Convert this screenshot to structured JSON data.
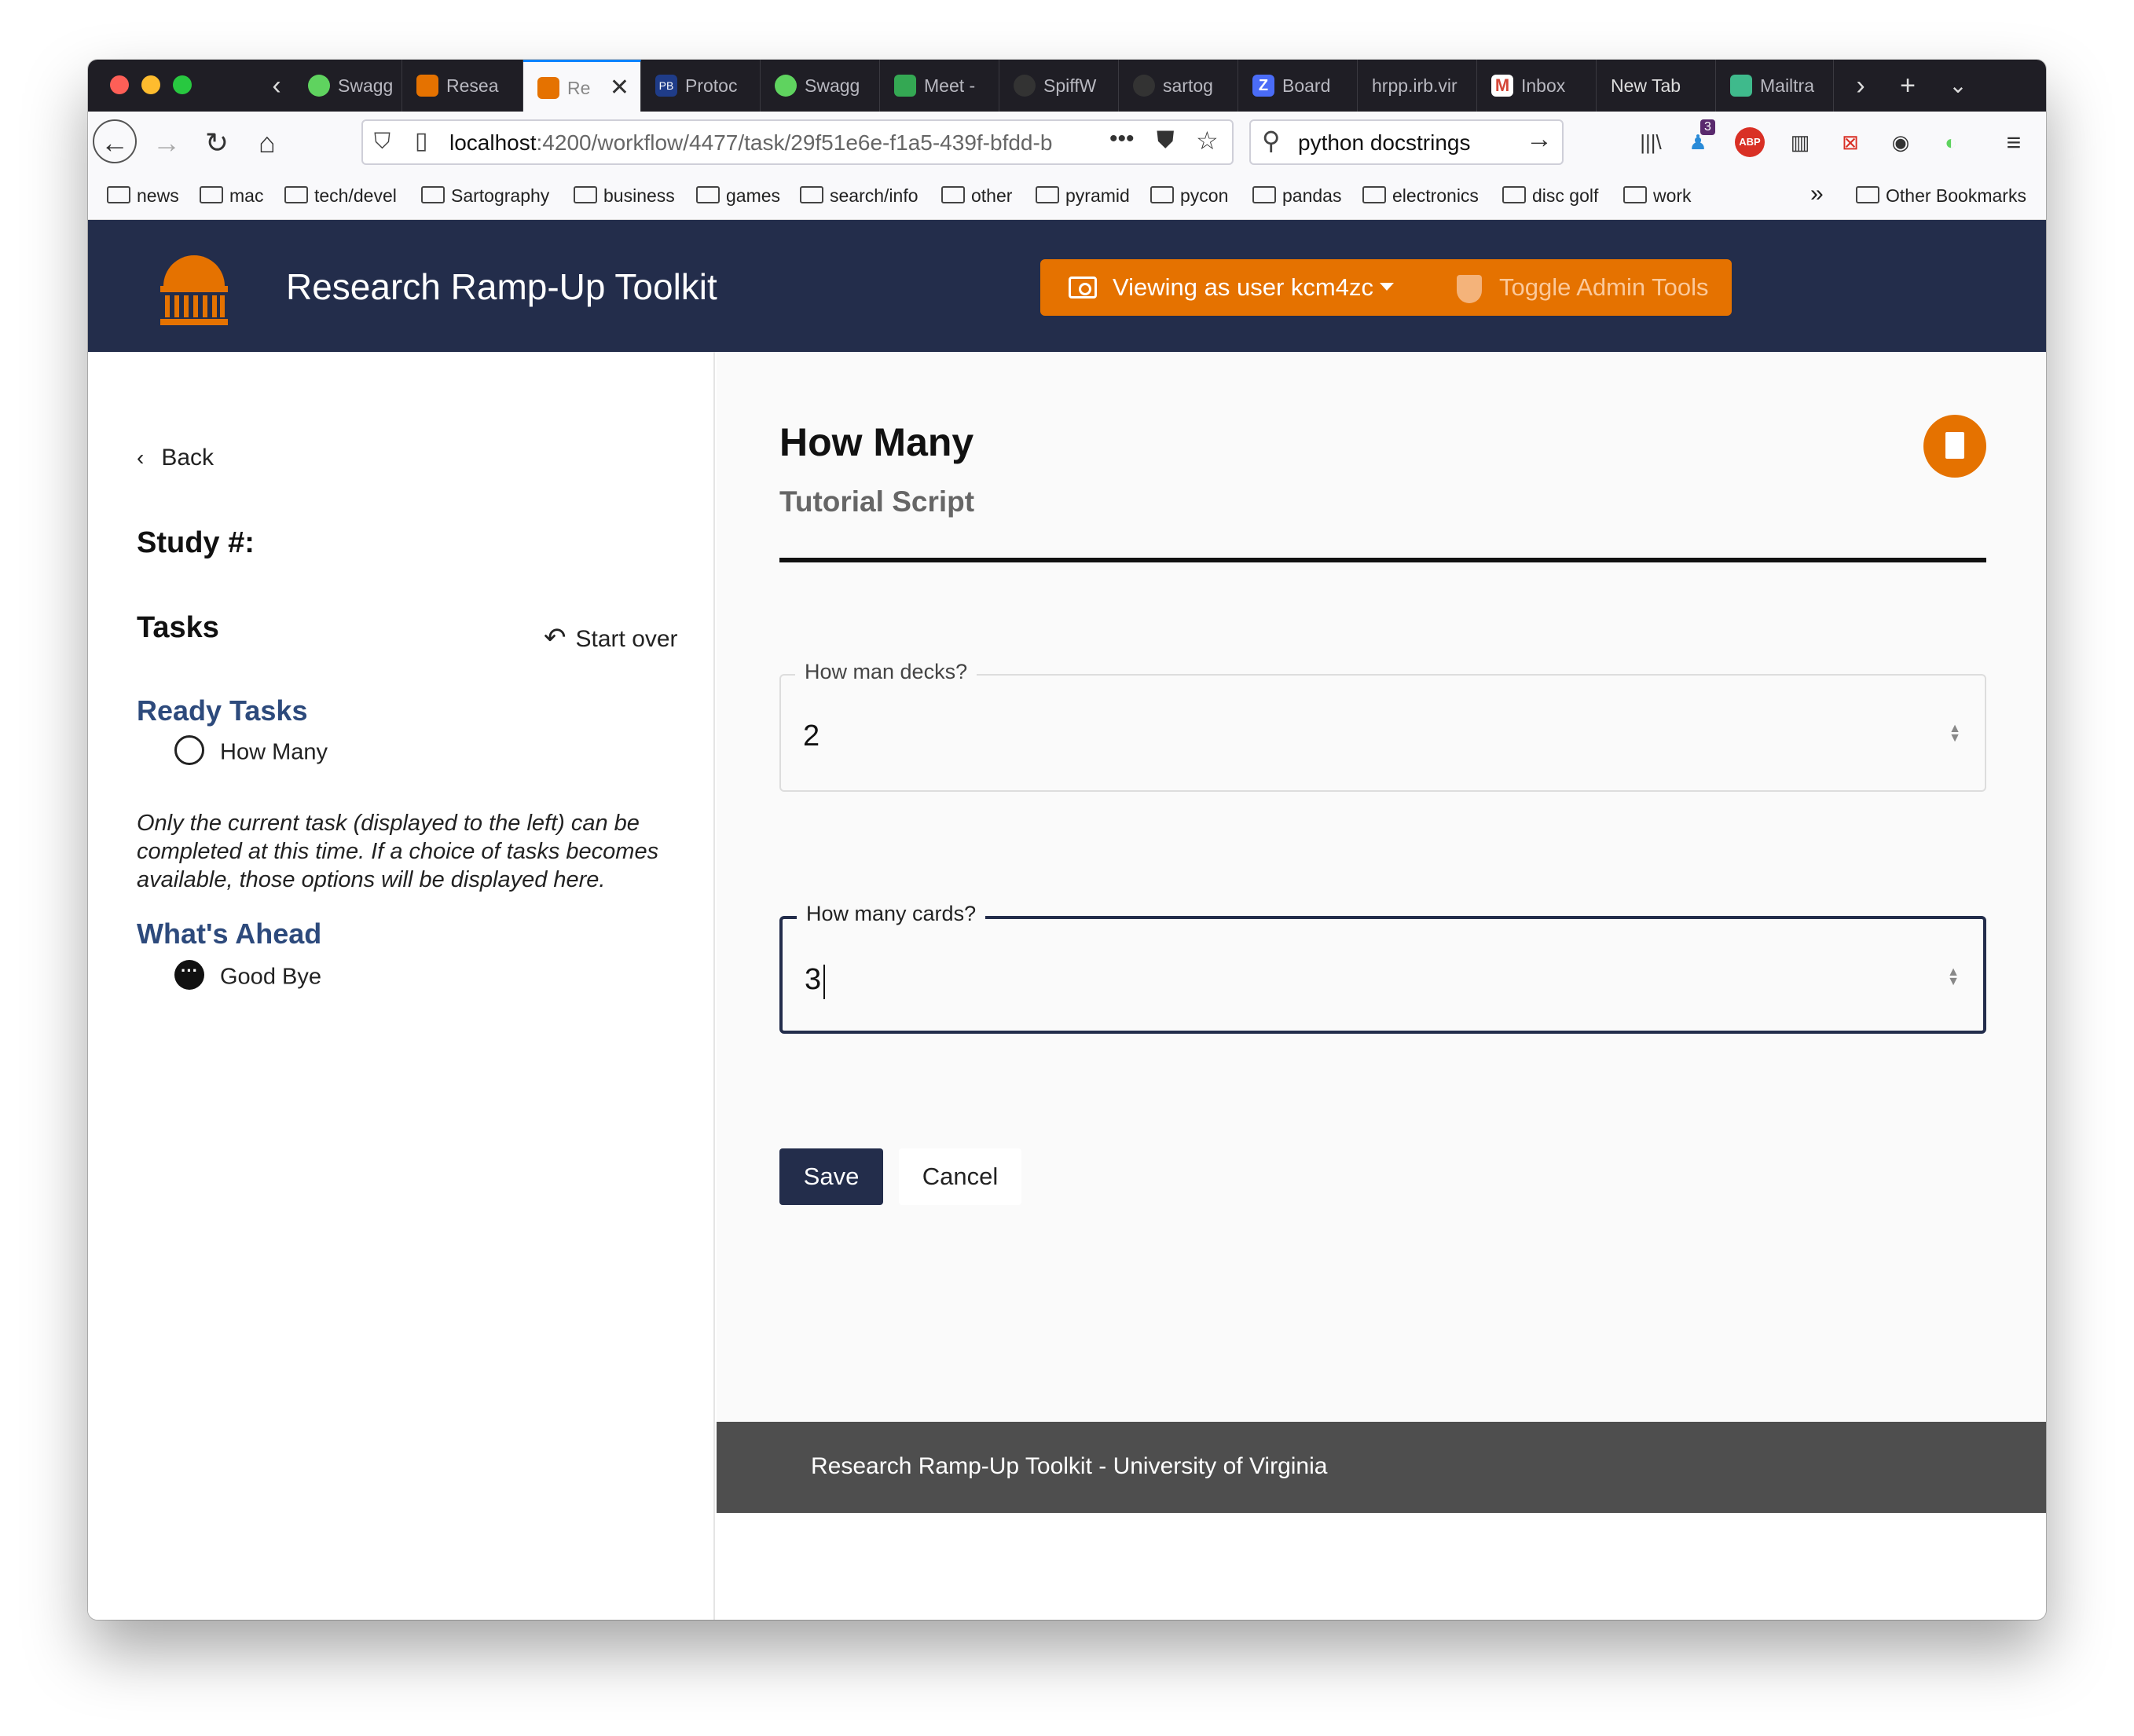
{
  "browser": {
    "tabs": [
      {
        "label": "Swagg",
        "color": "#5fd35f"
      },
      {
        "label": "Resea",
        "color": "#e57200"
      },
      {
        "label": "Re",
        "color": "#e57200"
      },
      {
        "label": "Protoc",
        "color": "#1f3c88",
        "fav_text": "PB"
      },
      {
        "label": "Swagg",
        "color": "#5fd35f"
      },
      {
        "label": "Meet -",
        "color": "#34a853"
      },
      {
        "label": "SpiffW",
        "color": "#333"
      },
      {
        "label": "sartog",
        "color": "#333"
      },
      {
        "label": "Board",
        "color": "#4a6cf7",
        "fav_text": "Z"
      },
      {
        "label": "hrpp.irb.vir",
        "color": ""
      },
      {
        "label": "Inbox",
        "color": "#d44638",
        "fav_text": "M"
      },
      {
        "label": "New Tab",
        "color": ""
      },
      {
        "label": "Mailtra",
        "color": "#3fba8c"
      }
    ],
    "url_host": "localhost",
    "url_path": ":4200/workflow/4477/task/29f51e6e-f1a5-439f-bfdd-b",
    "search_query": "python docstrings",
    "notification_count": "3",
    "bookmarks": [
      "news",
      "mac",
      "tech/devel",
      "Sartography",
      "business",
      "games",
      "search/info",
      "other",
      "pyramid",
      "pycon",
      "pandas",
      "electronics",
      "disc golf",
      "work"
    ],
    "other_bookmarks": "Other Bookmarks"
  },
  "header": {
    "title": "Research Ramp-Up Toolkit",
    "viewing_as": "Viewing as user kcm4zc",
    "toggle_admin": "Toggle Admin Tools"
  },
  "sidebar": {
    "back_label": "Back",
    "study_label": "Study #:",
    "tasks_label": "Tasks",
    "start_over": "Start over",
    "ready_heading": "Ready Tasks",
    "ready_tasks": [
      "How Many"
    ],
    "note": "Only the current task (displayed to the left) can be completed at this time. If a choice of tasks becomes available, those options will be displayed here.",
    "ahead_heading": "What's Ahead",
    "ahead_tasks": [
      "Good Bye"
    ]
  },
  "main": {
    "title": "How Many",
    "subtitle": "Tutorial Script",
    "fields": [
      {
        "label": "How man decks?",
        "value": "2"
      },
      {
        "label": "How many cards?",
        "value": "3"
      }
    ],
    "save_label": "Save",
    "cancel_label": "Cancel"
  },
  "footer": {
    "text": "Research Ramp-Up Toolkit - University of Virginia"
  },
  "colors": {
    "brand_navy": "#232d4b",
    "brand_orange": "#e57200",
    "section_blue": "#2d4a7c"
  }
}
